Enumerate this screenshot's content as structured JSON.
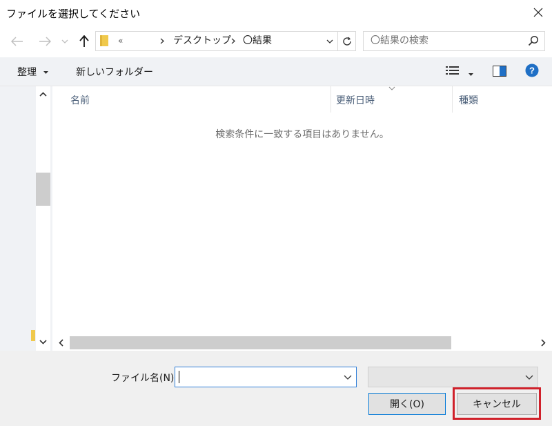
{
  "window": {
    "title": "ファイルを選択してください"
  },
  "address": {
    "overflow": "«",
    "crumbs": [
      "デスクトップ",
      "〇結果"
    ]
  },
  "search": {
    "placeholder": "〇結果の検索"
  },
  "toolbar": {
    "organize_label": "整理",
    "new_folder_label": "新しいフォルダー"
  },
  "columns": {
    "name": "名前",
    "date": "更新日時",
    "type": "種類"
  },
  "empty_message": "検索条件に一致する項目はありません。",
  "footer": {
    "filename_label": "ファイル名(N):",
    "filename_value": "",
    "filetype_value": "",
    "open_label": "開く(O)",
    "cancel_label": "キャンセル"
  },
  "colors": {
    "accent": "#0078d7",
    "highlight_outline": "#d0202a",
    "help_icon": "#1f6fc5",
    "folder": "#f0c94c"
  },
  "icons": [
    "close-icon",
    "back-arrow-icon",
    "forward-arrow-icon",
    "recent-dropdown-icon",
    "up-arrow-icon",
    "folder-icon",
    "chevron-right-icon",
    "chevron-down-icon",
    "refresh-icon",
    "search-icon",
    "view-menu-icon",
    "preview-pane-icon",
    "help-icon"
  ]
}
